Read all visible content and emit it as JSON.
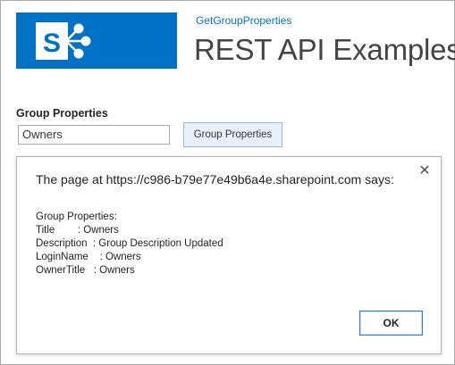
{
  "header": {
    "logo_icon": "sharepoint-logo-icon",
    "brand_color": "#0072c6",
    "site_link": "GetGroupProperties",
    "site_title": "REST API Examples"
  },
  "form": {
    "section_label": "Group Properties",
    "input_value": "Owners",
    "button_label": "Group Properties"
  },
  "dialog": {
    "title": "The page at https://c986-b79e77e49b6a4e.sharepoint.com says:",
    "close_icon": "close-icon",
    "lines": [
      "Group Properties:",
      "Title        : Owners",
      "Description  : Group Description Updated",
      "LoginName    : Owners",
      "OwnerTitle   : Owners"
    ],
    "ok_label": "OK"
  }
}
